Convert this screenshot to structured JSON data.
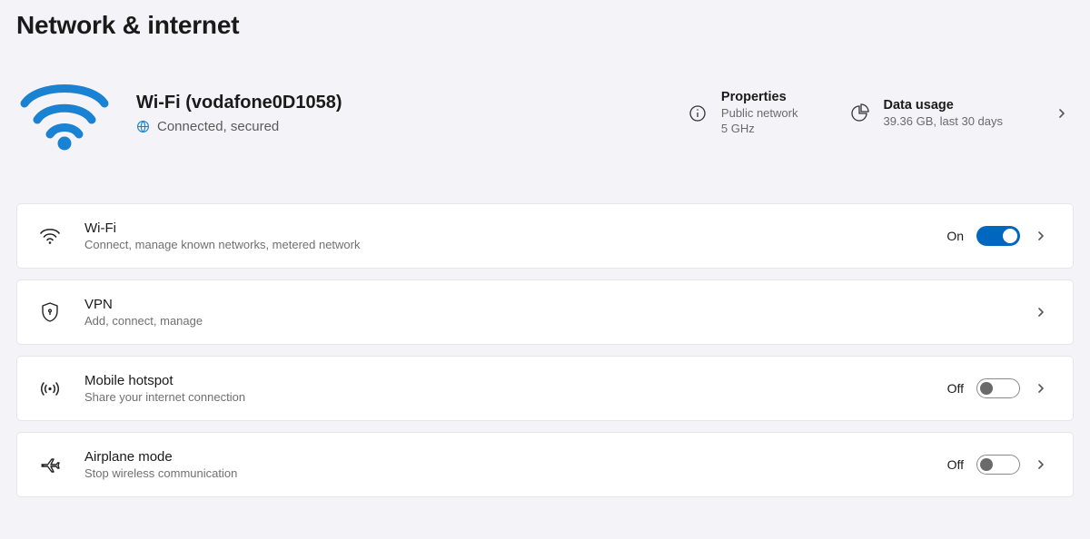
{
  "page": {
    "title": "Network & internet"
  },
  "connection": {
    "title": "Wi-Fi (vodafone0D1058)",
    "status": "Connected, secured"
  },
  "properties": {
    "heading": "Properties",
    "line1": "Public network",
    "line2": "5 GHz"
  },
  "dataUsage": {
    "heading": "Data usage",
    "detail": "39.36 GB, last 30 days"
  },
  "items": {
    "wifi": {
      "title": "Wi-Fi",
      "sub": "Connect, manage known networks, metered network",
      "state": "On"
    },
    "vpn": {
      "title": "VPN",
      "sub": "Add, connect, manage"
    },
    "hotspot": {
      "title": "Mobile hotspot",
      "sub": "Share your internet connection",
      "state": "Off"
    },
    "airplane": {
      "title": "Airplane mode",
      "sub": "Stop wireless communication",
      "state": "Off"
    }
  }
}
